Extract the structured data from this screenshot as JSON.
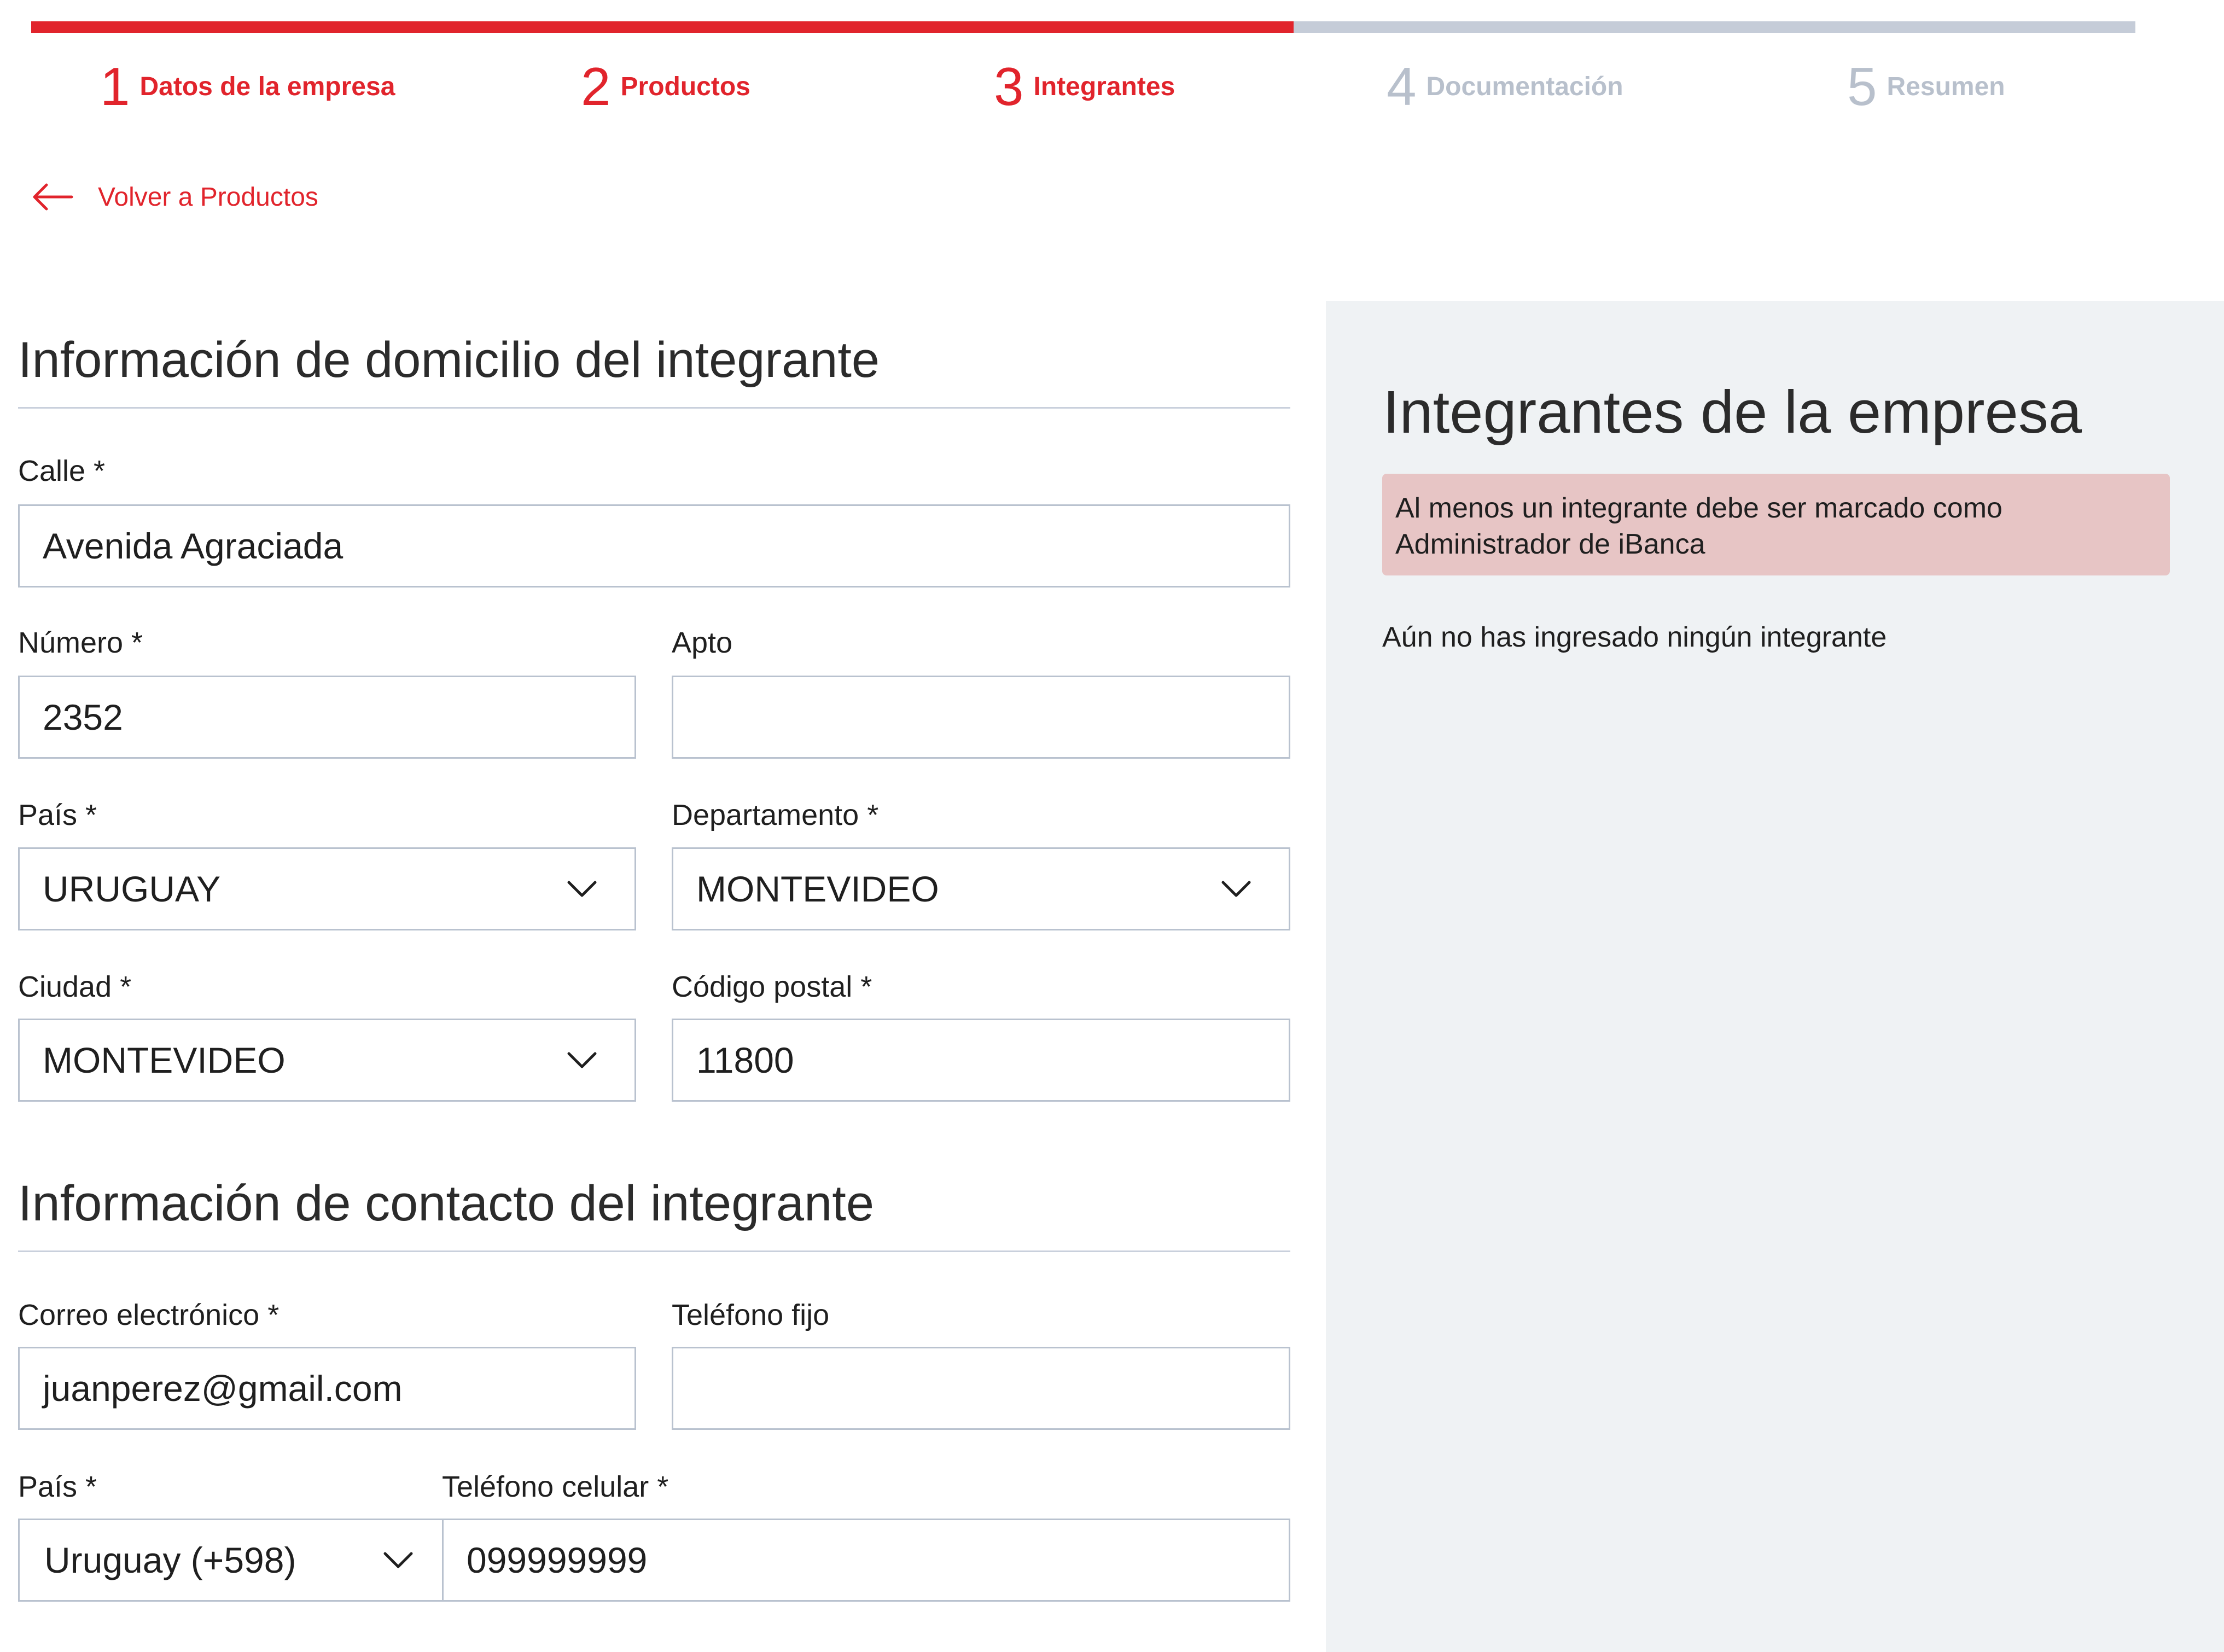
{
  "stepper": {
    "progress": 0.6,
    "steps": [
      {
        "number": "1",
        "label": "Datos de la empresa",
        "state": "active"
      },
      {
        "number": "2",
        "label": "Productos",
        "state": "active"
      },
      {
        "number": "3",
        "label": "Integrantes",
        "state": "active"
      },
      {
        "number": "4",
        "label": "Documentación",
        "state": "inactive"
      },
      {
        "number": "5",
        "label": "Resumen",
        "state": "inactive"
      }
    ]
  },
  "back_link": {
    "icon": "arrow-left-icon",
    "label": "Volver a Productos"
  },
  "address": {
    "title": "Información de domicilio del integrante",
    "street": {
      "label": "Calle *",
      "value": "Avenida Agraciada"
    },
    "number": {
      "label": "Número *",
      "value": "2352"
    },
    "apt": {
      "label": "Apto",
      "value": ""
    },
    "country": {
      "label": "País *",
      "value": "URUGUAY"
    },
    "department": {
      "label": "Departamento *",
      "value": "MONTEVIDEO"
    },
    "city": {
      "label": "Ciudad *",
      "value": "MONTEVIDEO"
    },
    "postal_code": {
      "label": "Código postal *",
      "value": "11800"
    }
  },
  "contact": {
    "title": "Información de contacto del integrante",
    "email": {
      "label": "Correo electrónico *",
      "value": "juanperez@gmail.com"
    },
    "landline": {
      "label": "Teléfono fijo",
      "value": ""
    },
    "country": {
      "label": "País *",
      "value": "Uruguay (+598)"
    },
    "mobile": {
      "label": "Teléfono celular *",
      "value": "099999999"
    }
  },
  "members_panel": {
    "title": "Integrantes de la empresa",
    "alert_line1": "Al menos un integrante debe ser marcado como",
    "alert_line2": "Administrador de iBanca",
    "empty_message": "Aún no has ingresado ningún integrante"
  },
  "colors": {
    "accent": "#e1242c",
    "inactive": "#b8c0cc",
    "panel_bg": "#eff2f4",
    "alert_bg": "#e7c5c5"
  }
}
